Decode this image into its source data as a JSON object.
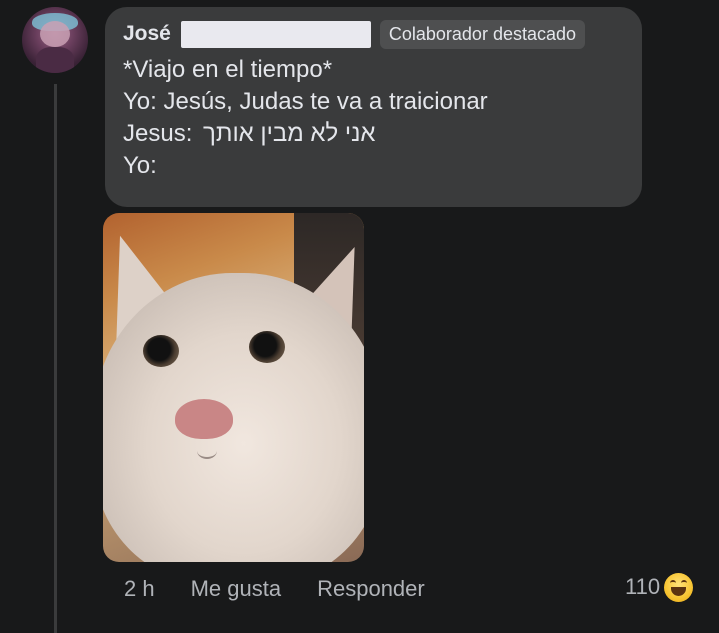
{
  "comment": {
    "author": "José",
    "badge": "Colaborador destacado",
    "lines": [
      "*Viajo en el tiempo*",
      "Yo: Jesús, Judas te va a traicionar"
    ],
    "hebrew_prefix": "Jesus:",
    "hebrew_text": "אני לא מבין אותך",
    "last_line": "Yo:"
  },
  "attachment": {
    "icon": "cat-photo"
  },
  "footer": {
    "time": "2 h",
    "like": "Me gusta",
    "reply": "Responder"
  },
  "reactions": {
    "count": "110",
    "icon": "haha-icon"
  },
  "colors": {
    "background": "#18191a",
    "bubble": "#3a3b3c",
    "text": "#e4e6eb",
    "secondary": "#b0b3b8"
  }
}
